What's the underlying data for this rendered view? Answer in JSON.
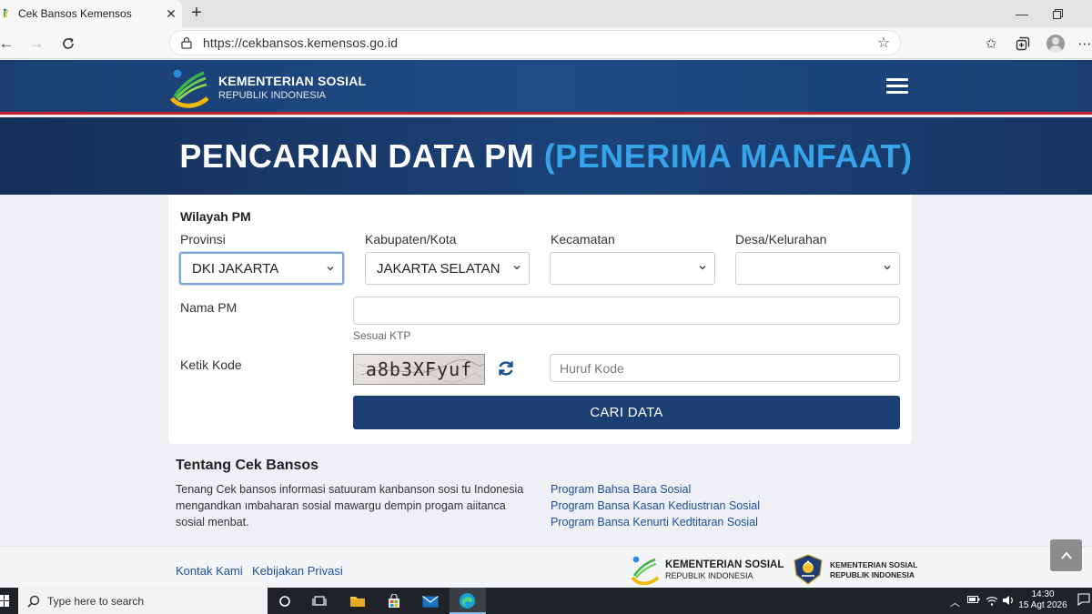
{
  "browser": {
    "tab_title": "Cek Bansos Kemensos",
    "url": "https://cekbansos.kemensos.go.id"
  },
  "site": {
    "org_name": "KEMENTERIAN SOSIAL",
    "org_sub": "REPUBLIK INDONESIA",
    "banner_title": "PENCARIAN DATA PM",
    "banner_highlight": "(PENERIMA MANFAAT)"
  },
  "form": {
    "section": "Wilayah PM",
    "provinsi_label": "Provinsi",
    "provinsi_value": "DKI JAKARTA",
    "kabupaten_label": "Kabupaten/Kota",
    "kabupaten_value": "JAKARTA SELATAN",
    "kecamatan_label": "Kecamatan",
    "kecamatan_value": "",
    "desa_label": "Desa/Kelurahan",
    "desa_value": "",
    "nama_label": "Nama PM",
    "nama_value": "",
    "nama_hint": "Sesuai KTP",
    "kode_label": "Ketik Kode",
    "captcha_text": "a8b3XFyuf",
    "kode_placeholder": "Huruf Kode",
    "submit_label": "CARI DATA"
  },
  "about": {
    "title": "Tentang Cek Bansos",
    "text": "Tenang Cek bansos informasi satuuram kanbanson sosi tu Indonesia mengandkan ımbaharan sosial mawargu dempin progam aiitanca sosial menbat.",
    "links": [
      "Program Bahsa Bara Sosial",
      "Program Bansa Kasan Kediustrıan Sosial",
      "Program Bansa Kenurti Kedtitaran Sosial"
    ]
  },
  "footer": {
    "contact": "Kontak Kami",
    "privacy": "Kebijakan Privasi",
    "logo1_line1": "KEMENTERIAN SOSIAL",
    "logo1_line2": "REPUBLIK INDONESIA",
    "logo2_line1": "KEMENTERIAN SOSIAL",
    "logo2_line2": "REPUBLIK INDONESIA"
  },
  "taskbar": {
    "search_placeholder": "Type here to search",
    "time": "14:30",
    "date": "15 Agt 2026"
  },
  "colors": {
    "header_navy": "#1b3f72",
    "accent_blue": "#36a4e8",
    "header_border_red": "#c8202f",
    "button_navy": "#1b3f72",
    "link_blue": "#1d4f9a"
  }
}
